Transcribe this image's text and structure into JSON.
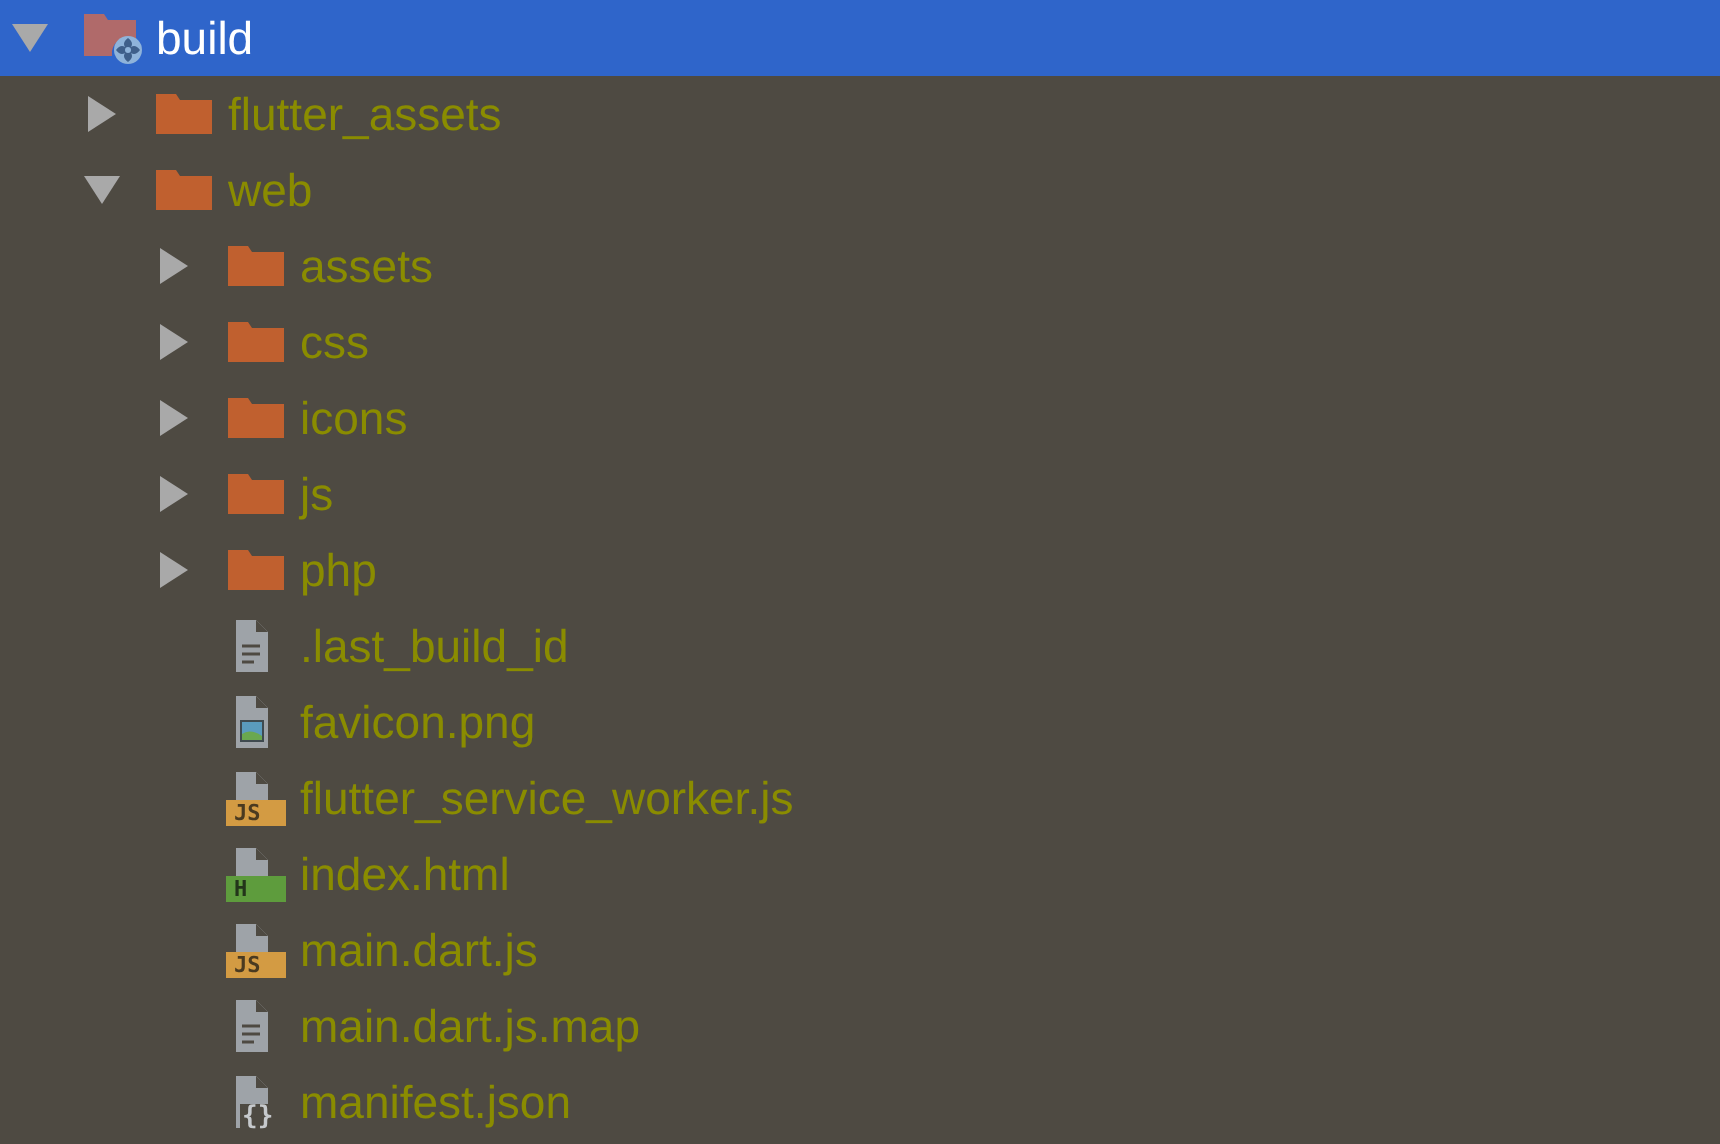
{
  "tree": [
    {
      "label": "build",
      "kind": "build-folder",
      "expanded": true,
      "selected": true,
      "children": [
        {
          "label": "flutter_assets",
          "kind": "folder",
          "expanded": false,
          "selected": false
        },
        {
          "label": "web",
          "kind": "folder",
          "expanded": true,
          "selected": false,
          "children": [
            {
              "label": "assets",
              "kind": "folder",
              "expanded": false,
              "selected": false
            },
            {
              "label": "css",
              "kind": "folder",
              "expanded": false,
              "selected": false
            },
            {
              "label": "icons",
              "kind": "folder",
              "expanded": false,
              "selected": false
            },
            {
              "label": "js",
              "kind": "folder",
              "expanded": false,
              "selected": false
            },
            {
              "label": "php",
              "kind": "folder",
              "expanded": false,
              "selected": false
            },
            {
              "label": ".last_build_id",
              "kind": "text",
              "selected": false
            },
            {
              "label": "favicon.png",
              "kind": "image",
              "selected": false
            },
            {
              "label": "flutter_service_worker.js",
              "kind": "js",
              "badge": "JS",
              "selected": false
            },
            {
              "label": "index.html",
              "kind": "html",
              "badge": "H",
              "selected": false
            },
            {
              "label": "main.dart.js",
              "kind": "js",
              "badge": "JS",
              "selected": false
            },
            {
              "label": "main.dart.js.map",
              "kind": "text",
              "selected": false
            },
            {
              "label": "manifest.json",
              "kind": "json",
              "badge": "{}",
              "selected": false
            }
          ]
        }
      ]
    }
  ]
}
